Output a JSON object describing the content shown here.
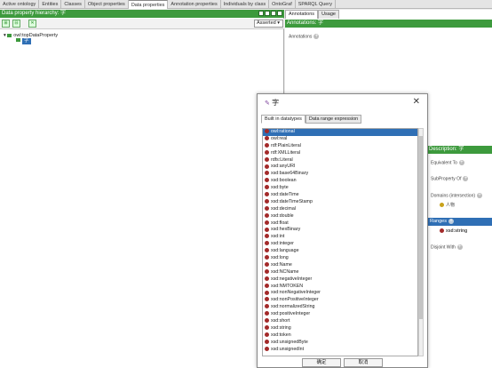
{
  "tabs": [
    "Active ontology",
    "Entities",
    "Classes",
    "Object properties",
    "Data properties",
    "Annotation properties",
    "Individuals by class",
    "OntoGraf",
    "SPARQL Query"
  ],
  "active_tab": 4,
  "left": {
    "header": "Data property hierarchy: 字",
    "asserted": "Asserted",
    "root": "owl:topDataProperty",
    "child": "字"
  },
  "right": {
    "tabs": [
      "Annotations",
      "Usage"
    ],
    "header": "Annotations: 字",
    "annotations_label": "Annotations"
  },
  "description": {
    "header": "Description: 字",
    "equivalent": "Equivalent To",
    "subproperty": "SubProperty Of",
    "domains": "Domains (intersection)",
    "domain_value": "人物",
    "ranges": "Ranges",
    "range_value": "xsd:string",
    "disjoint": "Disjoint With"
  },
  "dialog": {
    "title": "字",
    "tabs": [
      "Built in datatypes",
      "Data range expression"
    ],
    "items": [
      "owl:rational",
      "owl:real",
      "rdf:PlainLiteral",
      "rdf:XMLLiteral",
      "rdfs:Literal",
      "xsd:anyURI",
      "xsd:base64Binary",
      "xsd:boolean",
      "xsd:byte",
      "xsd:dateTime",
      "xsd:dateTimeStamp",
      "xsd:decimal",
      "xsd:double",
      "xsd:float",
      "xsd:hexBinary",
      "xsd:int",
      "xsd:integer",
      "xsd:language",
      "xsd:long",
      "xsd:Name",
      "xsd:NCName",
      "xsd:negativeInteger",
      "xsd:NMTOKEN",
      "xsd:nonNegativeInteger",
      "xsd:nonPositiveInteger",
      "xsd:normalizedString",
      "xsd:positiveInteger",
      "xsd:short",
      "xsd:string",
      "xsd:token",
      "xsd:unsignedByte",
      "xsd:unsignedInt"
    ],
    "ok": "确定",
    "cancel": "取消"
  },
  "colors": {
    "green": "#3d9a3d",
    "blue": "#2f6fb5",
    "dot": "#a32a2a"
  }
}
